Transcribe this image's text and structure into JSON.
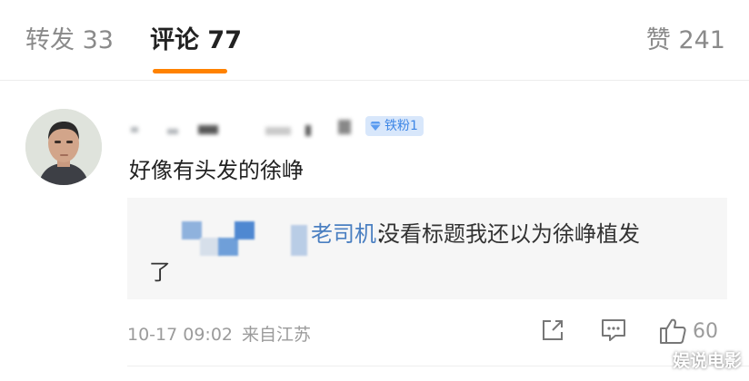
{
  "tabs": {
    "repost": {
      "label": "转发",
      "count": "33"
    },
    "comments": {
      "label": "评论",
      "count": "77"
    },
    "likes": {
      "label": "赞",
      "count": "241"
    }
  },
  "comment": {
    "badge": "铁粉1",
    "text": "好像有头发的徐峥",
    "reply": {
      "user_suffix": "老司机",
      "colon": ":",
      "text_line1": "没看标题我还以为徐峥植发",
      "text_line2": "了"
    },
    "time": "10-17 09:02",
    "source": "来自江苏",
    "like_count": "60"
  },
  "watermark": "娱说电影",
  "colors": {
    "accent": "#ff8200",
    "link": "#4a7fc1",
    "badge_bg": "#d8e7fb",
    "badge_fg": "#3d86e6"
  }
}
